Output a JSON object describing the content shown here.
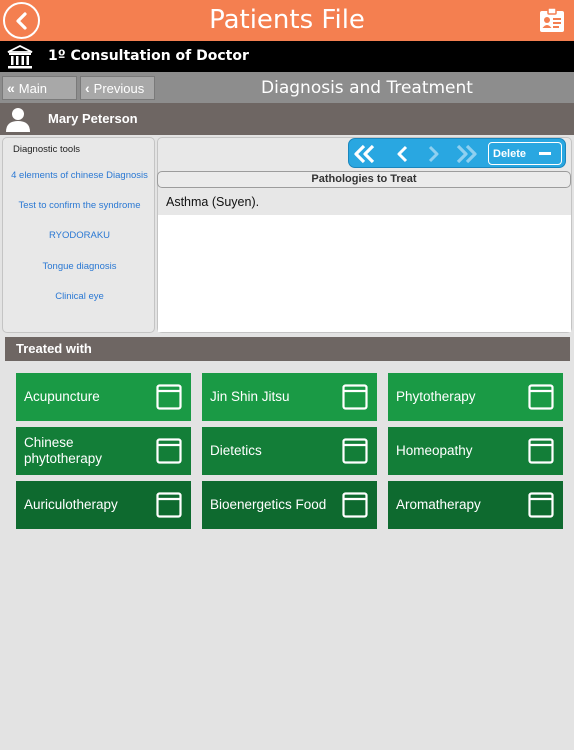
{
  "header": {
    "title": "Patients File",
    "icons": {
      "back": "back-circle-icon",
      "card": "id-card-icon"
    }
  },
  "consultation": {
    "title": "1º  Consultation of Doctor",
    "icon": "hospital-building-icon"
  },
  "nav": {
    "main_label": "Main",
    "previous_label": "Previous",
    "section_title": "Diagnosis and Treatment"
  },
  "patient": {
    "name": "Mary Peterson",
    "icon": "person-icon"
  },
  "diagnostic_tools": {
    "header": "Diagnostic tools",
    "links": [
      "4 elements of chinese Diagnosis",
      "Test to confirm the syndrome",
      "RYODORAKU",
      "Tongue diagnosis",
      "Clinical eye"
    ]
  },
  "pathologies": {
    "toolbar": {
      "delete_label": "Delete",
      "icons": [
        "first-icon",
        "previous-icon",
        "next-icon",
        "last-icon",
        "minus-icon"
      ]
    },
    "header": "Pathologies to Treat",
    "items": [
      "Asthma (Suyen)."
    ]
  },
  "treated_with": {
    "header": "Treated with",
    "tiles": [
      {
        "label": "Acupuncture",
        "shade": "#1a9a45"
      },
      {
        "label": "Jin Shin Jitsu",
        "shade": "#1a9a45"
      },
      {
        "label": "Phytotherapy",
        "shade": "#1a9a45"
      },
      {
        "label": "Chinese phytotherapy",
        "shade": "#137e38"
      },
      {
        "label": "Dietetics",
        "shade": "#137e38"
      },
      {
        "label": "Homeopathy",
        "shade": "#137e38"
      },
      {
        "label": "Auriculotherapy",
        "shade": "#0e6a2f"
      },
      {
        "label": "Bioenergetics Food",
        "shade": "#0e6a2f"
      },
      {
        "label": "Aromatherapy",
        "shade": "#0e6a2f"
      }
    ]
  },
  "colors": {
    "accent": "#f47f50",
    "blue_toolbar": "#29a7e1",
    "link_blue": "#2a78d3"
  }
}
